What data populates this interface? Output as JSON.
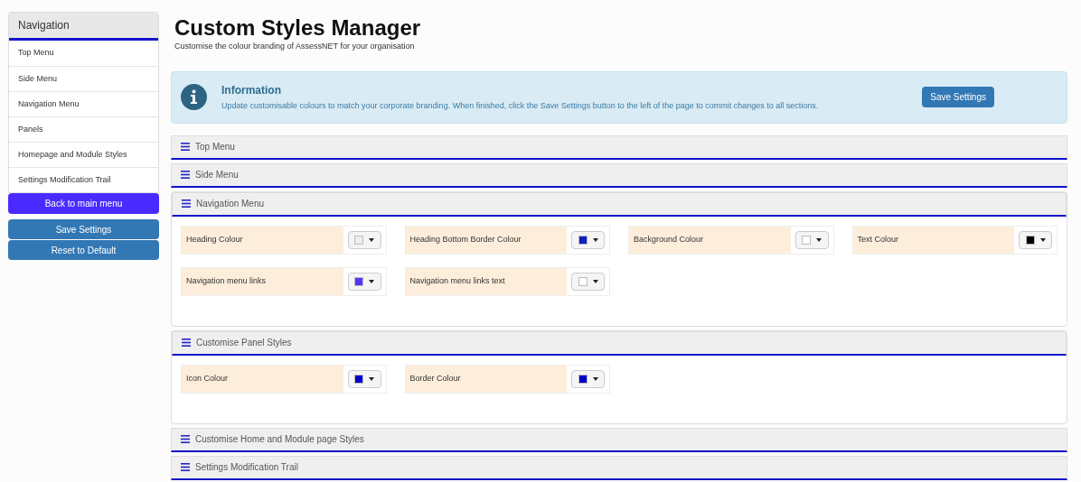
{
  "sidebar": {
    "title": "Navigation",
    "items": [
      "Top Menu",
      "Side Menu",
      "Navigation Menu",
      "Panels",
      "Homepage and Module Styles",
      "Settings Modification Trail"
    ],
    "back_button": "Back to main menu",
    "buttons": [
      "Save Settings",
      "Reset to Default"
    ]
  },
  "header": {
    "title": "Custom Styles Manager",
    "subtitle": "Customise the colour branding of AssessNET for your organisation"
  },
  "info": {
    "title": "Information",
    "text": "Update customisable colours to match your corporate branding. When finished, click the Save Settings button to the left of the page to commit changes to all sections.",
    "button": "Save Settings"
  },
  "sections": [
    {
      "title": "Top Menu",
      "expanded": false
    },
    {
      "title": "Side Menu",
      "expanded": false
    },
    {
      "title": "Navigation Menu",
      "expanded": true,
      "fields": [
        {
          "label": "Heading Colour",
          "color": "#eeeeee"
        },
        {
          "label": "Heading Bottom Border Colour",
          "color": "#0a1fc4"
        },
        {
          "label": "Background Colour",
          "color": "#ffffff"
        },
        {
          "label": "Text Colour",
          "color": "#000000"
        },
        {
          "label": "Navigation menu links",
          "color": "#5533ff"
        },
        {
          "label": "Navigation menu links text",
          "color": "#ffffff"
        }
      ]
    },
    {
      "title": "Customise Panel Styles",
      "expanded": true,
      "fields": [
        {
          "label": "Icon Colour",
          "color": "#0000cc"
        },
        {
          "label": "Border Colour",
          "color": "#0000cc"
        }
      ]
    },
    {
      "title": "Customise Home and Module page Styles",
      "expanded": false
    },
    {
      "title": "Settings Modification Trail",
      "expanded": false
    }
  ]
}
